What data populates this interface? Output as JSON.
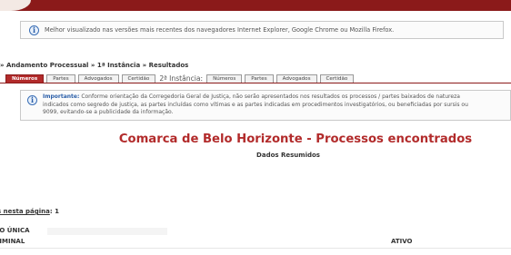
{
  "colors": {
    "brand": "#8b1a1a",
    "accent_red": "#b22b2b",
    "info_blue": "#2a5ea8"
  },
  "browser_notice": {
    "icon": "info-icon",
    "text": "Melhor visualizado nas versões mais recentes dos navegadores Internet Explorer, Google Chrome ou Mozilla Firefox."
  },
  "breadcrumb": "» Andamento Processual » 1ª Instância » Resultados",
  "tabs_first_instance": [
    "Números",
    "Partes",
    "Advogados",
    "Certidão"
  ],
  "second_instance_label": "2ª Instância:",
  "tabs_second_instance": [
    "Números",
    "Partes",
    "Advogados",
    "Certidão"
  ],
  "important": {
    "icon": "info-icon",
    "label": "Importante:",
    "line1": "Conforme orientação da Corregedoria Geral de Justiça, não serão apresentados nos resultados os processos / partes baixados de natureza",
    "line2": "indicados como segredo de justiça, as partes incluídas como vítimas e as partes indicadas em procedimentos investigatórios, ou beneficiadas por sursis ou",
    "line3": "9099, evitando-se a publicidade da informação."
  },
  "results": {
    "title": "Comarca de Belo Horizonte - Processos encontrados",
    "subtitle": "Dados Resumidos"
  },
  "page_count": {
    "label": "s nesta página",
    "value": ": 1"
  },
  "rows": {
    "section": "ÃO ÚNICA",
    "type": "RIMINAL",
    "status": "ATIVO"
  }
}
